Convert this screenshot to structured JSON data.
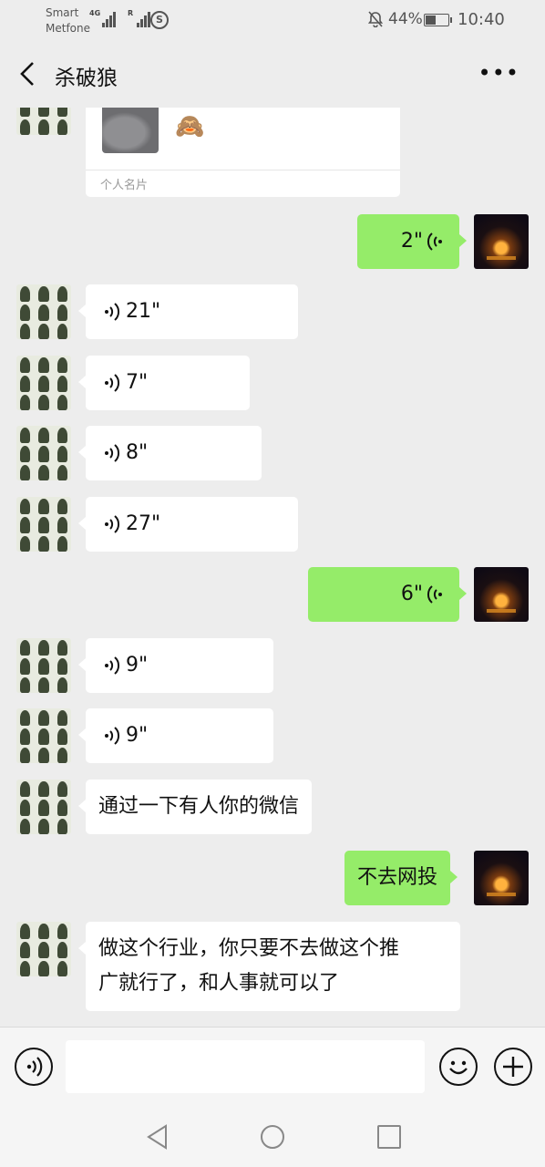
{
  "status_bar": {
    "carrier_line1": "Smart",
    "carrier_line2": "Metfone",
    "network1": "4G",
    "network2": "R",
    "battery_percent": "44%",
    "battery_level": 0.44,
    "time": "10:40"
  },
  "header": {
    "title": "杀破狼",
    "more": "•••"
  },
  "card": {
    "label": "个人名片",
    "emoji": "🙈"
  },
  "messages": [
    {
      "side": "right",
      "type": "voice",
      "duration": "2\""
    },
    {
      "side": "left",
      "type": "voice",
      "duration": "21\""
    },
    {
      "side": "left",
      "type": "voice",
      "duration": "7\""
    },
    {
      "side": "left",
      "type": "voice",
      "duration": "8\""
    },
    {
      "side": "left",
      "type": "voice",
      "duration": "27\""
    },
    {
      "side": "right",
      "type": "voice",
      "duration": "6\""
    },
    {
      "side": "left",
      "type": "voice",
      "duration": "9\""
    },
    {
      "side": "left",
      "type": "voice",
      "duration": "9\""
    },
    {
      "side": "left",
      "type": "text",
      "text": "通过一下有人你的微信"
    },
    {
      "side": "right",
      "type": "text",
      "text": "不去网投"
    },
    {
      "side": "left",
      "type": "text",
      "text_line1": "做这个行业，你只要不去做这个推",
      "text_line2": "广就行了，和人事就可以了"
    }
  ],
  "input": {
    "placeholder": ""
  },
  "colors": {
    "chat_background": "#ededed",
    "outgoing_bubble": "#95ec69",
    "incoming_bubble": "#ffffff"
  },
  "icons": [
    "back-arrow-icon",
    "more-dots-icon",
    "voice-wave-icon",
    "voice-mode-icon",
    "emoji-icon",
    "plus-icon",
    "nav-back-icon",
    "nav-home-icon",
    "nav-recent-icon"
  ]
}
